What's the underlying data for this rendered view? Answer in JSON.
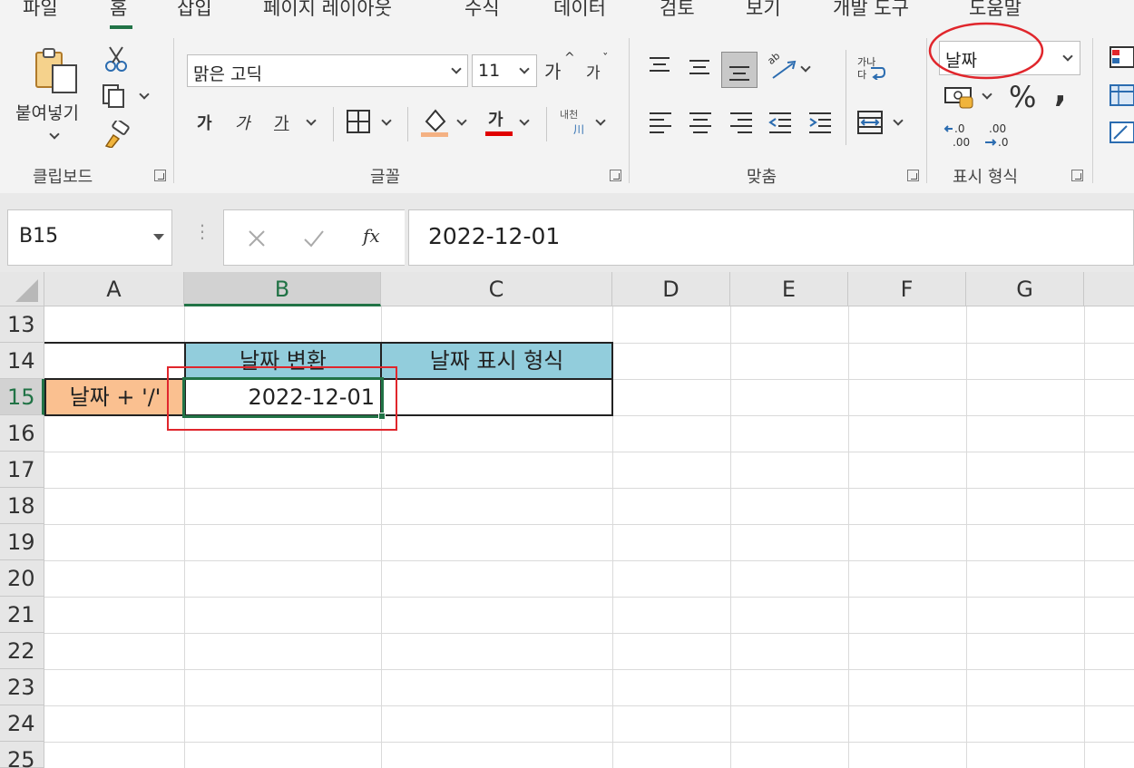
{
  "tabs": [
    "파일",
    "홈",
    "삽입",
    "페이지 레이아웃",
    "수식",
    "데이터",
    "검토",
    "보기",
    "개발 도구",
    "도움말"
  ],
  "active_tab": "홈",
  "clipboard": {
    "paste_label": "붙여넣기",
    "group_label": "클립보드"
  },
  "font": {
    "name": "맑은 고딕",
    "size": "11",
    "bold": "가",
    "italic": "가",
    "underline": "가",
    "color_glyph": "가",
    "grow": "가",
    "shrink": "가",
    "phonetic_top": "내천",
    "phonetic_bottom": "川",
    "group_label": "글꼴"
  },
  "alignment": {
    "group_label": "맞춤",
    "wrap_top": "가나",
    "wrap_bottom": "다",
    "orient": "ab"
  },
  "number": {
    "format": "날짜",
    "percent": "%",
    "comma": ",",
    "group_label": "표시 형식"
  },
  "formula_bar": {
    "name_box": "B15",
    "fx": "fx",
    "value": "2022-12-01"
  },
  "columns": [
    "A",
    "B",
    "C",
    "D",
    "E",
    "F",
    "G"
  ],
  "rows": [
    "13",
    "14",
    "15",
    "16",
    "17",
    "18",
    "19",
    "20",
    "21",
    "22",
    "23",
    "24",
    "25"
  ],
  "cells": {
    "B14": "날짜 변환",
    "C14": "날짜 표시 형식",
    "A15": "날짜 + '/'",
    "B15": "2022-12-01"
  },
  "colors": {
    "accent": "#217346",
    "header_fill": "#92cddc",
    "label_fill": "#fac090",
    "annotation": "#e0262c"
  }
}
